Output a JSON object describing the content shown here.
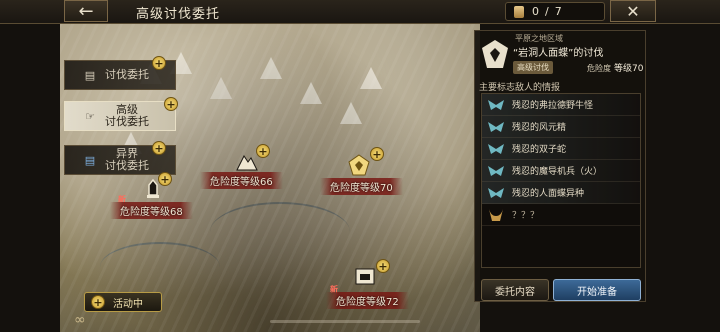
{
  "header": {
    "title": "高级讨伐委托",
    "back_icon": "arrow-left-icon",
    "close_icon": "close-icon",
    "counter": {
      "current": "0",
      "separator": "/",
      "total": "7"
    }
  },
  "tabs": [
    {
      "label": "讨伐委托",
      "active": false,
      "icon": "scroll-icon"
    },
    {
      "label": "高级\n讨伐委托",
      "active": true,
      "icon": "hand-pointer-icon"
    },
    {
      "label": "异界\n讨伐委托",
      "active": false,
      "icon": "blue-scroll-icon"
    }
  ],
  "markers": [
    {
      "label": "危险度等级68",
      "new_tag": "新",
      "icon": "bell-tower-icon"
    },
    {
      "label": "危险度等级66",
      "new_tag": "",
      "icon": "mountain-icon"
    },
    {
      "label": "危险度等级70",
      "new_tag": "",
      "icon": "boss-emblem-icon",
      "selected": true
    },
    {
      "label": "危险度等级72",
      "new_tag": "新",
      "icon": "shield-icon"
    }
  ],
  "active_event": {
    "label": "活动中"
  },
  "panel": {
    "region": "平原之地区域",
    "quest_name": "“岩洞人面蝶”的讨伐",
    "tag": "高级讨伐",
    "danger_label": "危险度",
    "danger_value": "等级70",
    "enemies_title": "主要标志敌人的情报",
    "enemies": [
      {
        "name": "残忍的弗拉德野牛怪",
        "icon": "wing-emblem-icon"
      },
      {
        "name": "残忍的风元精",
        "icon": "wing-emblem-icon"
      },
      {
        "name": "残忍的双子蛇",
        "icon": "wing-emblem-icon"
      },
      {
        "name": "残忍的魔导机兵（火）",
        "icon": "wing-emblem-icon"
      },
      {
        "name": "残忍的人面蝶异种",
        "icon": "wing-emblem-icon"
      },
      {
        "name": "？？？",
        "icon": "horn-emblem-icon"
      }
    ],
    "detail_button": "委托内容",
    "start_button": "开始准备"
  },
  "colors": {
    "accent_gold": "#c69a2a",
    "danger_red": "#782019",
    "start_blue": "#3d6a98"
  }
}
